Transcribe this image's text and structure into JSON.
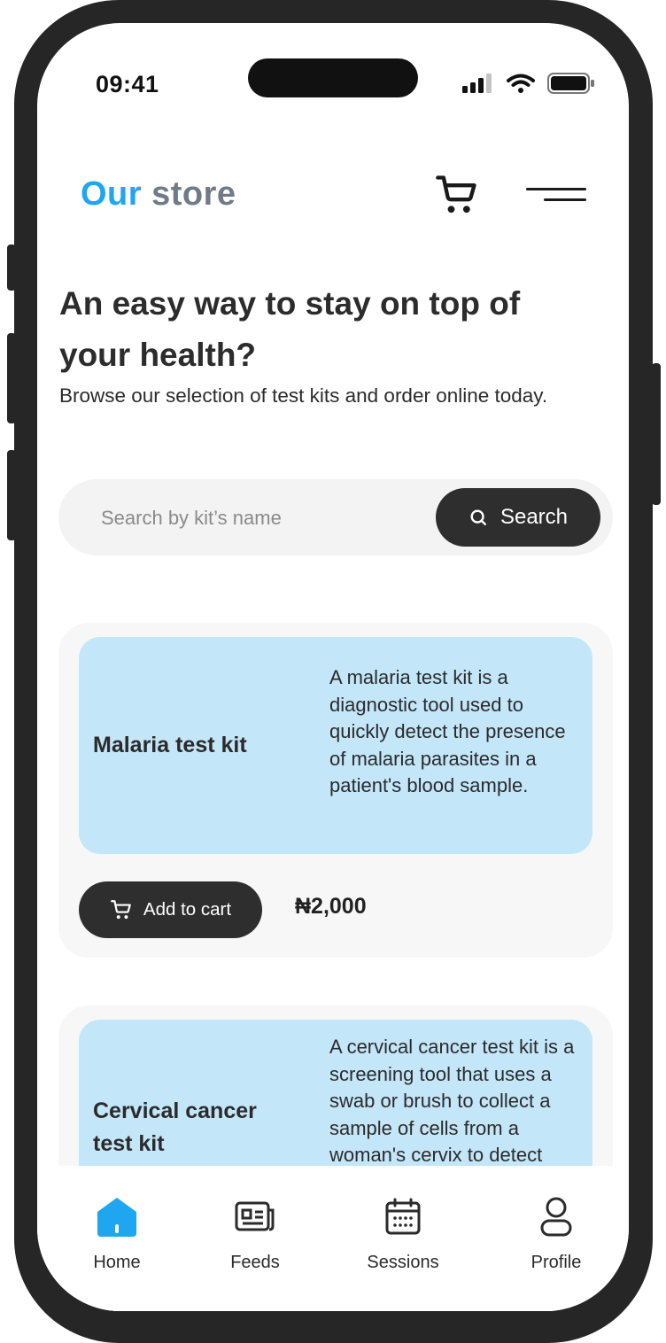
{
  "status_bar": {
    "time": "09:41"
  },
  "header": {
    "title_part1": "Our",
    "title_part2": "store"
  },
  "hero": {
    "headline": "An easy way to stay on top of your health?",
    "subtitle": "Browse our selection of test kits and order online today."
  },
  "search": {
    "placeholder": "Search by kit’s name",
    "button_label": "Search"
  },
  "products": [
    {
      "name": "Malaria test kit",
      "description": "A malaria test kit is a diagnostic tool used to quickly detect the presence of malaria parasites in a patient's blood sample.",
      "add_label": "Add to cart",
      "price": "₦2,000"
    },
    {
      "name": "Cervical cancer test kit",
      "description": "A cervical cancer test kit is a screening tool that uses a swab or brush to collect a sample of cells from a woman's cervix to detect"
    }
  ],
  "nav": {
    "items": [
      {
        "label": "Home",
        "icon": "home-icon",
        "active": true
      },
      {
        "label": "Feeds",
        "icon": "newspaper-icon",
        "active": false
      },
      {
        "label": "Sessions",
        "icon": "calendar-icon",
        "active": false
      },
      {
        "label": "Profile",
        "icon": "user-icon",
        "active": false
      }
    ]
  },
  "colors": {
    "accent": "#1ea7f0",
    "card_info_bg": "#c3e6f9",
    "dark_button": "#2e2e2e"
  }
}
